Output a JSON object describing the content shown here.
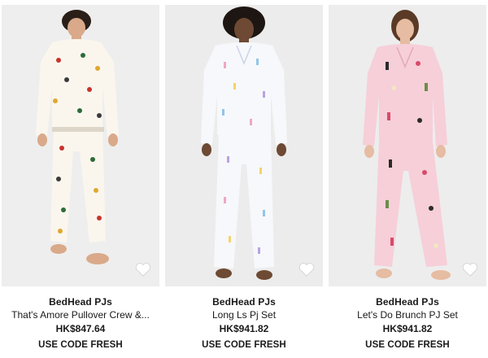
{
  "products": [
    {
      "brand": "BedHead PJs",
      "name": "That's Amore Pullover Crew &...",
      "price": "HK$847.64",
      "promo": "USE CODE FRESH",
      "icon": "heart-icon",
      "colors": {
        "backdrop": "#eeeeee",
        "garment": "#faf6ee",
        "print": [
          "#c8342c",
          "#2e6b3a",
          "#e0a82e",
          "#3b3b3b"
        ]
      }
    },
    {
      "brand": "BedHead PJs",
      "name": "Long Ls Pj Set",
      "price": "HK$941.82",
      "promo": "USE CODE FRESH",
      "icon": "heart-icon",
      "colors": {
        "backdrop": "#ececec",
        "garment": "#f7f8fb",
        "print": [
          "#f0a7c0",
          "#8fc5ea",
          "#f4d36a",
          "#b9a3e0"
        ]
      }
    },
    {
      "brand": "BedHead PJs",
      "name": "Let's Do Brunch PJ Set",
      "price": "HK$941.82",
      "promo": "USE CODE FRESH",
      "icon": "heart-icon",
      "colors": {
        "backdrop": "#ededed",
        "garment": "#f6cfd9",
        "print": [
          "#2b2b2b",
          "#d94a6a",
          "#f2e6c0",
          "#6a8f4a"
        ]
      }
    }
  ]
}
